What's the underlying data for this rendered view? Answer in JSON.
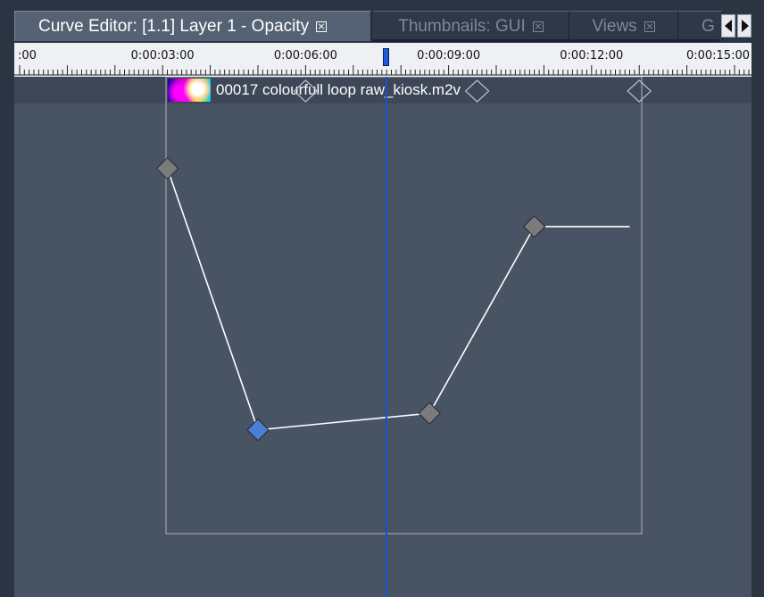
{
  "tabs": [
    {
      "label": "Curve Editor: [1.1] Layer 1 - Opacity",
      "active": true
    },
    {
      "label": "Thumbnails: GUI",
      "active": false
    },
    {
      "label": "Views",
      "active": false
    },
    {
      "label": "G",
      "active": false
    }
  ],
  "ruler": {
    "labels": [
      ":00",
      "0:00:03:00",
      "0:00:06:00",
      "0:00:09:00",
      "0:00:12:00",
      "0:00:15:00"
    ],
    "seconds": [
      0,
      3,
      6,
      9,
      12,
      15
    ]
  },
  "clip": {
    "name": "00017 colourfull loop raw_kiosk.m2v",
    "thumbnail_icon": "video-thumbnail"
  },
  "playhead": {
    "time_seconds": 7.7,
    "color": "#1f4fd1"
  },
  "keyframes": [
    {
      "time_seconds": 6.0,
      "value": 1.0,
      "selected": false,
      "outline": true
    },
    {
      "time_seconds": 9.6,
      "value": 1.0,
      "selected": false,
      "outline": true
    },
    {
      "time_seconds": 13.0,
      "value": 1.0,
      "selected": false,
      "outline": true
    }
  ],
  "curve": {
    "points": [
      {
        "time_seconds": 3.1,
        "value": 0.88
      },
      {
        "time_seconds": 5.0,
        "value": 0.25
      },
      {
        "time_seconds": 8.6,
        "value": 0.29
      },
      {
        "time_seconds": 10.8,
        "value": 0.74
      }
    ],
    "hold_until_seconds": 12.8,
    "selected_index": 1
  },
  "colors": {
    "background": "#485363",
    "curve": "#ffffff",
    "keyframe": "#7b7b7b",
    "selected_keyframe": "#4a7fd6"
  }
}
